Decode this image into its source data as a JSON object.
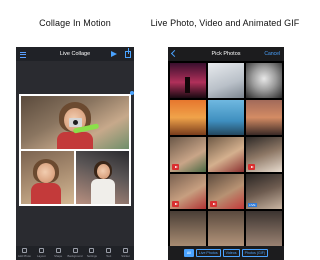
{
  "left_panel": {
    "caption": "Collage In Motion",
    "app": {
      "nav_title": "Live Collage",
      "toolbar": [
        {
          "label": "Add Photo",
          "icon": "add-photo-icon"
        },
        {
          "label": "Layout",
          "icon": "layout-icon"
        },
        {
          "label": "Shape",
          "icon": "shape-icon"
        },
        {
          "label": "Background",
          "icon": "background-icon"
        },
        {
          "label": "Settings",
          "icon": "settings-icon"
        },
        {
          "label": "Text",
          "icon": "text-icon"
        },
        {
          "label": "Sticker",
          "icon": "sticker-icon"
        }
      ]
    }
  },
  "right_panel": {
    "caption": "Live Photo, Video and Animated GIF",
    "app": {
      "nav_title": "Pick Photos",
      "cancel_label": "Cancel",
      "filters": [
        {
          "label": "All",
          "active": true
        },
        {
          "label": "Live Photos",
          "active": false
        },
        {
          "label": "Videos",
          "active": false
        },
        {
          "label": "Photos (GIF)",
          "active": false
        }
      ],
      "badge_live_label": "LIVE"
    }
  },
  "colors": {
    "accent": "#4aa3ff",
    "video_badge": "#d93030",
    "live_badge": "#2f7bd9",
    "app_bar": "#202227"
  }
}
